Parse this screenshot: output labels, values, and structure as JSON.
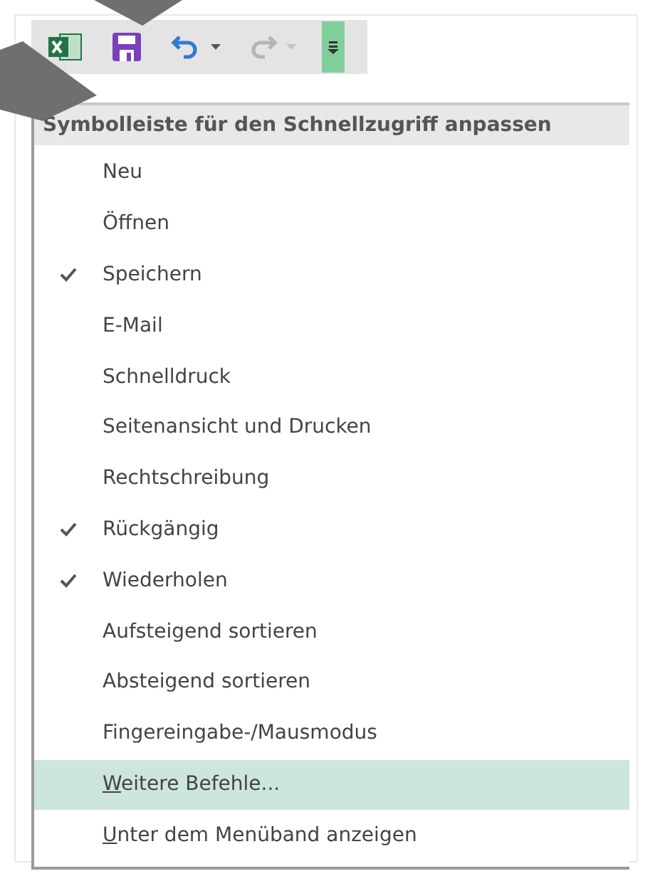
{
  "toolbar": {
    "buttons": [
      {
        "kind": "app",
        "disabled": false
      },
      {
        "kind": "save",
        "disabled": false
      },
      {
        "kind": "undo",
        "disabled": false
      },
      {
        "kind": "redo",
        "disabled": true
      },
      {
        "kind": "customize",
        "disabled": false,
        "selected": true
      }
    ]
  },
  "menu": {
    "title": "Symbolleiste für den Schnellzugriff anpassen",
    "items": [
      {
        "kind": "toggle",
        "label": "Neu",
        "checked": false,
        "selected": false
      },
      {
        "kind": "toggle",
        "label": "Öffnen",
        "checked": false,
        "selected": false
      },
      {
        "kind": "toggle",
        "label": "Speichern",
        "checked": true,
        "selected": false
      },
      {
        "kind": "toggle",
        "label": "E-Mail",
        "checked": false,
        "selected": false
      },
      {
        "kind": "toggle",
        "label": "Schnelldruck",
        "checked": false,
        "selected": false
      },
      {
        "kind": "toggle",
        "label": "Seitenansicht und Drucken",
        "checked": false,
        "selected": false
      },
      {
        "kind": "toggle",
        "label": "Rechtschreibung",
        "checked": false,
        "selected": false
      },
      {
        "kind": "toggle",
        "label": "Rückgängig",
        "checked": true,
        "selected": false
      },
      {
        "kind": "toggle",
        "label": "Wiederholen",
        "checked": true,
        "selected": false
      },
      {
        "kind": "toggle",
        "label": "Aufsteigend sortieren",
        "checked": false,
        "selected": false
      },
      {
        "kind": "toggle",
        "label": "Absteigend sortieren",
        "checked": false,
        "selected": false
      },
      {
        "kind": "toggle",
        "label": "Fingereingabe-/Mausmodus",
        "checked": false,
        "selected": false
      },
      {
        "kind": "command",
        "label": "Weitere Befehle...",
        "selected": true
      },
      {
        "kind": "command",
        "label": "Unter dem Menüband anzeigen",
        "selected": false
      }
    ]
  }
}
